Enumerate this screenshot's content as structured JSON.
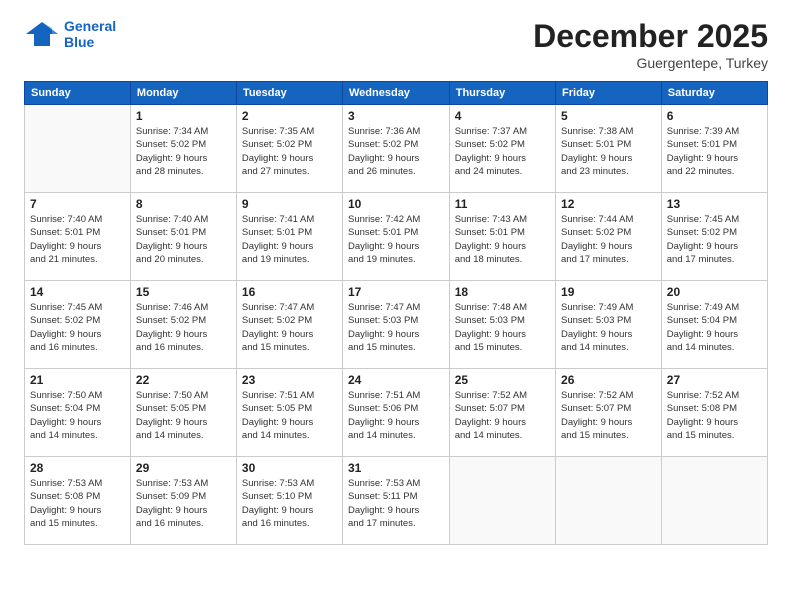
{
  "header": {
    "logo_line1": "General",
    "logo_line2": "Blue",
    "month": "December 2025",
    "location": "Guergentepe, Turkey"
  },
  "weekdays": [
    "Sunday",
    "Monday",
    "Tuesday",
    "Wednesday",
    "Thursday",
    "Friday",
    "Saturday"
  ],
  "weeks": [
    [
      {
        "day": "",
        "info": ""
      },
      {
        "day": "1",
        "info": "Sunrise: 7:34 AM\nSunset: 5:02 PM\nDaylight: 9 hours\nand 28 minutes."
      },
      {
        "day": "2",
        "info": "Sunrise: 7:35 AM\nSunset: 5:02 PM\nDaylight: 9 hours\nand 27 minutes."
      },
      {
        "day": "3",
        "info": "Sunrise: 7:36 AM\nSunset: 5:02 PM\nDaylight: 9 hours\nand 26 minutes."
      },
      {
        "day": "4",
        "info": "Sunrise: 7:37 AM\nSunset: 5:02 PM\nDaylight: 9 hours\nand 24 minutes."
      },
      {
        "day": "5",
        "info": "Sunrise: 7:38 AM\nSunset: 5:01 PM\nDaylight: 9 hours\nand 23 minutes."
      },
      {
        "day": "6",
        "info": "Sunrise: 7:39 AM\nSunset: 5:01 PM\nDaylight: 9 hours\nand 22 minutes."
      }
    ],
    [
      {
        "day": "7",
        "info": "Sunrise: 7:40 AM\nSunset: 5:01 PM\nDaylight: 9 hours\nand 21 minutes."
      },
      {
        "day": "8",
        "info": "Sunrise: 7:40 AM\nSunset: 5:01 PM\nDaylight: 9 hours\nand 20 minutes."
      },
      {
        "day": "9",
        "info": "Sunrise: 7:41 AM\nSunset: 5:01 PM\nDaylight: 9 hours\nand 19 minutes."
      },
      {
        "day": "10",
        "info": "Sunrise: 7:42 AM\nSunset: 5:01 PM\nDaylight: 9 hours\nand 19 minutes."
      },
      {
        "day": "11",
        "info": "Sunrise: 7:43 AM\nSunset: 5:01 PM\nDaylight: 9 hours\nand 18 minutes."
      },
      {
        "day": "12",
        "info": "Sunrise: 7:44 AM\nSunset: 5:02 PM\nDaylight: 9 hours\nand 17 minutes."
      },
      {
        "day": "13",
        "info": "Sunrise: 7:45 AM\nSunset: 5:02 PM\nDaylight: 9 hours\nand 17 minutes."
      }
    ],
    [
      {
        "day": "14",
        "info": "Sunrise: 7:45 AM\nSunset: 5:02 PM\nDaylight: 9 hours\nand 16 minutes."
      },
      {
        "day": "15",
        "info": "Sunrise: 7:46 AM\nSunset: 5:02 PM\nDaylight: 9 hours\nand 16 minutes."
      },
      {
        "day": "16",
        "info": "Sunrise: 7:47 AM\nSunset: 5:02 PM\nDaylight: 9 hours\nand 15 minutes."
      },
      {
        "day": "17",
        "info": "Sunrise: 7:47 AM\nSunset: 5:03 PM\nDaylight: 9 hours\nand 15 minutes."
      },
      {
        "day": "18",
        "info": "Sunrise: 7:48 AM\nSunset: 5:03 PM\nDaylight: 9 hours\nand 15 minutes."
      },
      {
        "day": "19",
        "info": "Sunrise: 7:49 AM\nSunset: 5:03 PM\nDaylight: 9 hours\nand 14 minutes."
      },
      {
        "day": "20",
        "info": "Sunrise: 7:49 AM\nSunset: 5:04 PM\nDaylight: 9 hours\nand 14 minutes."
      }
    ],
    [
      {
        "day": "21",
        "info": "Sunrise: 7:50 AM\nSunset: 5:04 PM\nDaylight: 9 hours\nand 14 minutes."
      },
      {
        "day": "22",
        "info": "Sunrise: 7:50 AM\nSunset: 5:05 PM\nDaylight: 9 hours\nand 14 minutes."
      },
      {
        "day": "23",
        "info": "Sunrise: 7:51 AM\nSunset: 5:05 PM\nDaylight: 9 hours\nand 14 minutes."
      },
      {
        "day": "24",
        "info": "Sunrise: 7:51 AM\nSunset: 5:06 PM\nDaylight: 9 hours\nand 14 minutes."
      },
      {
        "day": "25",
        "info": "Sunrise: 7:52 AM\nSunset: 5:07 PM\nDaylight: 9 hours\nand 14 minutes."
      },
      {
        "day": "26",
        "info": "Sunrise: 7:52 AM\nSunset: 5:07 PM\nDaylight: 9 hours\nand 15 minutes."
      },
      {
        "day": "27",
        "info": "Sunrise: 7:52 AM\nSunset: 5:08 PM\nDaylight: 9 hours\nand 15 minutes."
      }
    ],
    [
      {
        "day": "28",
        "info": "Sunrise: 7:53 AM\nSunset: 5:08 PM\nDaylight: 9 hours\nand 15 minutes."
      },
      {
        "day": "29",
        "info": "Sunrise: 7:53 AM\nSunset: 5:09 PM\nDaylight: 9 hours\nand 16 minutes."
      },
      {
        "day": "30",
        "info": "Sunrise: 7:53 AM\nSunset: 5:10 PM\nDaylight: 9 hours\nand 16 minutes."
      },
      {
        "day": "31",
        "info": "Sunrise: 7:53 AM\nSunset: 5:11 PM\nDaylight: 9 hours\nand 17 minutes."
      },
      {
        "day": "",
        "info": ""
      },
      {
        "day": "",
        "info": ""
      },
      {
        "day": "",
        "info": ""
      }
    ]
  ]
}
